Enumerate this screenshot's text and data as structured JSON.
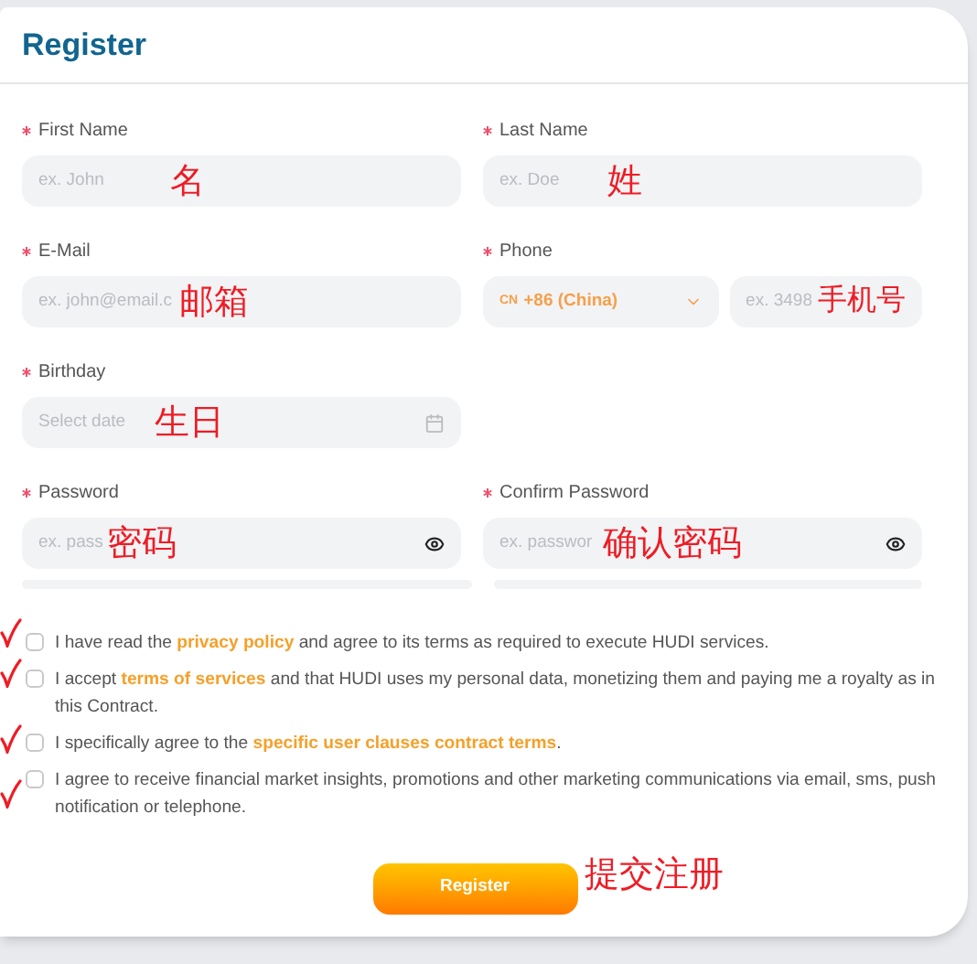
{
  "title": "Register",
  "fields": [
    {
      "kind": "text",
      "label": "First Name",
      "required": true,
      "placeholder": "ex. John",
      "note": "名"
    },
    {
      "kind": "text",
      "label": "Last Name",
      "required": true,
      "placeholder": "ex. Doe",
      "note": "姓"
    },
    {
      "kind": "text",
      "label": "E-Mail",
      "required": true,
      "placeholder": "ex. john@email.c",
      "note": "邮箱"
    },
    {
      "kind": "phone",
      "label": "Phone",
      "required": true,
      "country_code": "CN",
      "country": "+86 (China)",
      "placeholder": "ex. 3498",
      "note": "手机号"
    },
    {
      "kind": "date",
      "label": "Birthday",
      "required": true,
      "placeholder": "Select date",
      "note": "生日"
    },
    {
      "kind": "blank"
    },
    {
      "kind": "password",
      "label": "Password",
      "required": true,
      "placeholder": "ex. pass",
      "note": "密码"
    },
    {
      "kind": "password",
      "label": "Confirm Password",
      "required": true,
      "placeholder": "ex. passwor",
      "note": "确认密码"
    }
  ],
  "agreements": [
    {
      "text": "I have read the **privacy policy** and agree to its terms as required to execute HUDI services.",
      "checked": false
    },
    {
      "text": "I accept **terms of services** and that HUDI uses my personal data, monetizing them and paying me a royalty as in this Contract.",
      "checked": false
    },
    {
      "text": "I specifically agree to the **specific user clauses contract terms**.",
      "checked": false
    },
    {
      "text": "I agree to receive financial market insights, promotions and other marketing communications via email, sms, push notification or telephone.",
      "checked": false
    }
  ],
  "submit": "Register",
  "submit_note": "提交注册"
}
